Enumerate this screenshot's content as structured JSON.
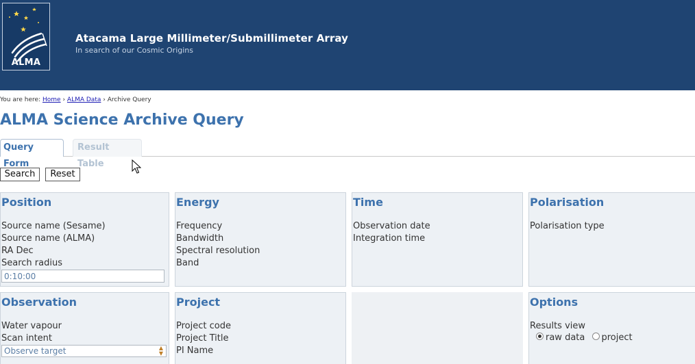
{
  "header": {
    "logo_text": "ALMA",
    "title": "Atacama Large Millimeter/Submillimeter Array",
    "subtitle": "In search of our Cosmic Origins"
  },
  "breadcrumb": {
    "prefix": "You are here:",
    "items": [
      "Home",
      "ALMA Data",
      "Archive Query"
    ],
    "separator": "›"
  },
  "page_title": "ALMA Science Archive Query",
  "tabs": [
    {
      "label": "Query Form",
      "active": true
    },
    {
      "label": "Result Table",
      "active": false
    }
  ],
  "buttons": {
    "search": "Search",
    "reset": "Reset"
  },
  "panels": {
    "position": {
      "title": "Position",
      "fields": [
        "Source name (Sesame)",
        "Source name (ALMA)",
        "RA Dec",
        "Search radius"
      ],
      "search_radius_value": "0:10:00"
    },
    "energy": {
      "title": "Energy",
      "fields": [
        "Frequency",
        "Bandwidth",
        "Spectral resolution",
        "Band"
      ]
    },
    "time": {
      "title": "Time",
      "fields": [
        "Observation date",
        "Integration time"
      ]
    },
    "polarisation": {
      "title": "Polarisation",
      "fields": [
        "Polarisation type"
      ]
    },
    "observation": {
      "title": "Observation",
      "fields": [
        "Water vapour",
        "Scan intent"
      ],
      "scan_intent_selected": "Observe target"
    },
    "project": {
      "title": "Project",
      "fields": [
        "Project code",
        "Project Title",
        "PI Name"
      ]
    },
    "options": {
      "title": "Options",
      "fields": [
        "Results view"
      ],
      "results_view_options": [
        "raw data",
        "project"
      ],
      "results_view_selected": "raw data"
    }
  },
  "colors": {
    "header_bg": "#1f4472",
    "accent": "#3d72ad",
    "panel_bg": "#edf1f5"
  }
}
